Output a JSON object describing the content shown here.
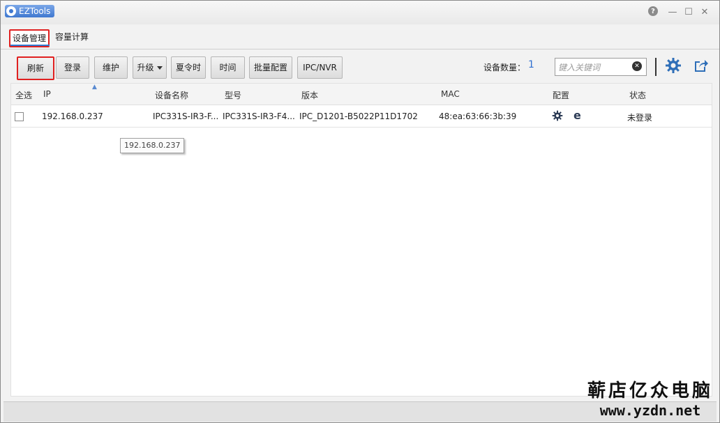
{
  "window": {
    "app_title": "EZTools",
    "help_glyph": "?",
    "min_glyph": "—",
    "max_glyph": "☐",
    "close_glyph": "✕"
  },
  "tabs": [
    {
      "label": "设备管理",
      "selected": true
    },
    {
      "label": "容量计算",
      "selected": false
    }
  ],
  "toolbar": {
    "refresh": "刷新",
    "login": "登录",
    "maintain": "维护",
    "upgrade": "升级",
    "dst": "夏令时",
    "time": "时间",
    "batch_config": "批量配置",
    "ipc_nvr": "IPC/NVR",
    "device_count_label": "设备数量：",
    "device_count": "1",
    "search_placeholder": "键入关键词",
    "icons": [
      "settings-gear-icon",
      "export-share-icon"
    ]
  },
  "table": {
    "columns": [
      "全选",
      "IP",
      "设备名称",
      "型号",
      "版本",
      "MAC",
      "配置",
      "状态"
    ],
    "sort_column": "IP",
    "rows": [
      {
        "checked": false,
        "ip": "192.168.0.237",
        "name": "IPC331S-IR3-F...",
        "model": "IPC331S-IR3-F4...",
        "version": "IPC_D1201-B5022P11D1702",
        "mac": "48:ea:63:66:3b:39",
        "config_icons": [
          "gear-icon",
          "ie-browser-icon"
        ],
        "status": "未登录"
      }
    ]
  },
  "tooltip": {
    "text": "192.168.0.237"
  },
  "watermark": {
    "line1": "蕲店亿众电脑",
    "line2": "www.yzdn.net"
  },
  "colors": {
    "highlight_border": "#e02020",
    "accent": "#2f78d0",
    "count_value": "#2f6fd0"
  }
}
